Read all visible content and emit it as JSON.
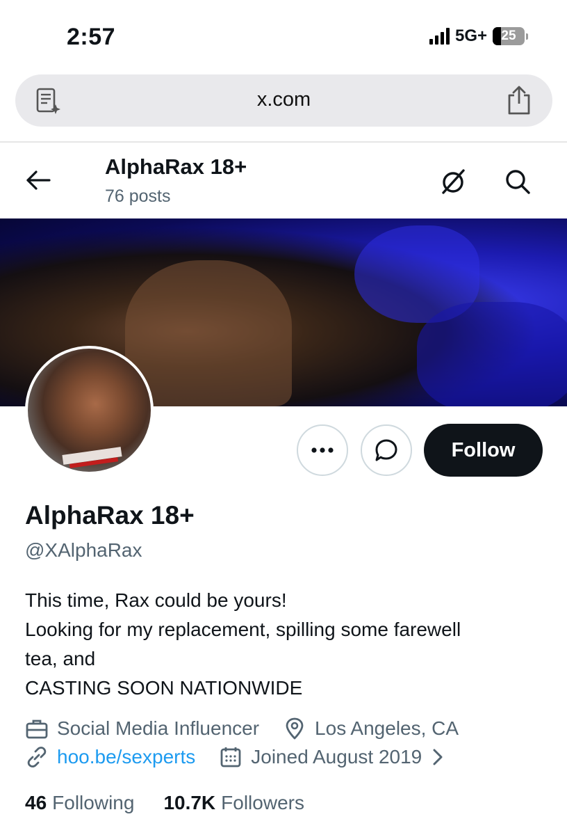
{
  "status_bar": {
    "time": "2:57",
    "network": "5G+",
    "battery": "25"
  },
  "browser": {
    "url": "x.com"
  },
  "header": {
    "name": "AlphaRax 18+",
    "posts": "76 posts"
  },
  "actions": {
    "more_label": "•••",
    "follow_label": "Follow"
  },
  "profile": {
    "name": "AlphaRax 18+",
    "handle": "@XAlphaRax",
    "bio_lines": [
      "This time, Rax could be yours!",
      "Looking for my replacement, spilling some farewell",
      "tea, and",
      "CASTING SOON NATIONWIDE"
    ],
    "category": "Social Media Influencer",
    "location": "Los Angeles, CA",
    "link": "hoo.be/sexperts",
    "joined": "Joined August 2019"
  },
  "stats": {
    "following_count": "46",
    "following_label": "Following",
    "followers_count": "10.7K",
    "followers_label": "Followers"
  }
}
